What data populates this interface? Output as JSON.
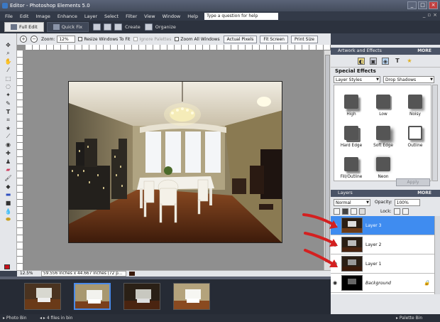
{
  "window": {
    "title": "Editor - Photoshop Elements 5.0",
    "min": "_",
    "max": "□",
    "close": "×"
  },
  "menu": {
    "items": [
      "File",
      "Edit",
      "Image",
      "Enhance",
      "Layer",
      "Select",
      "Filter",
      "View",
      "Window",
      "Help"
    ],
    "help_placeholder": "Type a question for help"
  },
  "modebar": {
    "full_edit": "Full Edit",
    "quick_fix": "Quick Fix",
    "create": "Create",
    "organize": "Organize"
  },
  "options": {
    "zoom_label": "Zoom:",
    "zoom_value": "12%",
    "resize_windows": "Resize Windows To Fit",
    "ignore_palettes": "Ignore Palettes",
    "zoom_all_windows": "Zoom All Windows",
    "actual_pixels": "Actual Pixels",
    "fit_screen": "Fit Screen",
    "print_size": "Print Size"
  },
  "status": {
    "zoom": "12.5%",
    "doc_info": "59.556 inches x 44.667 inches (72 p..."
  },
  "photo_bin": {
    "label": "Photo Bin",
    "count": "4 files in bin",
    "palette_bin": "Palette Bin",
    "selected_index": 1
  },
  "artwork": {
    "header": "Artwork and Effects",
    "more": "MORE",
    "section_title": "Special Effects",
    "dropdown_left": "Layer Styles",
    "dropdown_right": "Drop Shadows",
    "effects": [
      "High",
      "Low",
      "Noisy",
      "Hard Edge",
      "Soft Edge",
      "Outline",
      "Fill/Outline",
      "Neon"
    ],
    "apply": "Apply"
  },
  "layers": {
    "header": "Layers",
    "more": "MORE",
    "blend_mode": "Normal",
    "opacity_label": "Opacity:",
    "opacity_value": "100%",
    "lock_label": "Lock:",
    "items": [
      {
        "name": "Layer 3",
        "active": true
      },
      {
        "name": "Layer 2",
        "active": false
      },
      {
        "name": "Layer 1",
        "active": false
      },
      {
        "name": "Background",
        "active": false
      }
    ]
  },
  "colors": {
    "accent": "#3f8cf0",
    "annotation": "#d42020",
    "foreground": "#c8101a"
  }
}
